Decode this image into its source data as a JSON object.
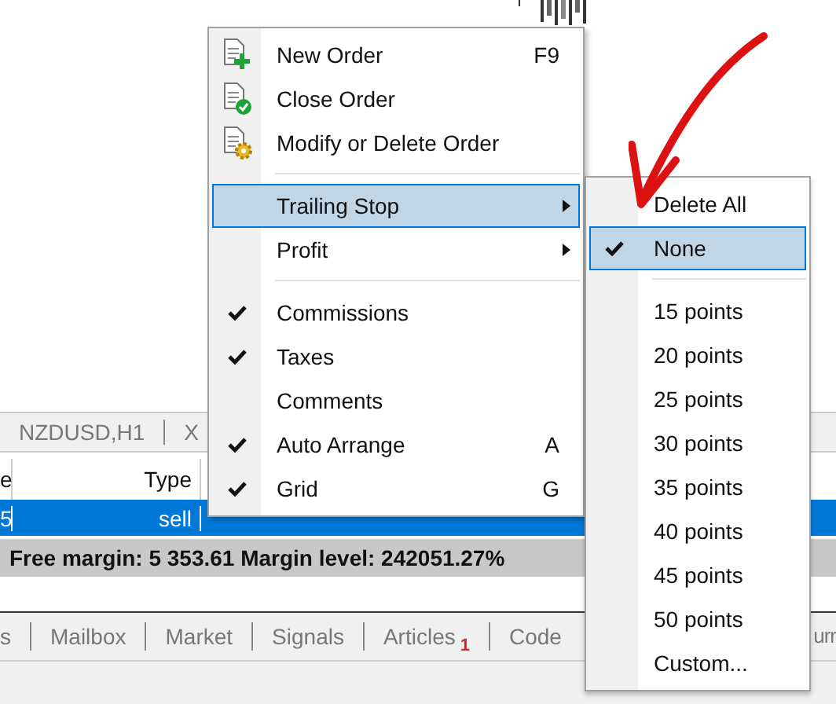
{
  "chart_tabs": [
    {
      "label": "NZDUSD,H1"
    },
    {
      "label": "X"
    }
  ],
  "table": {
    "columns": [
      "e",
      "Type"
    ],
    "rows": [
      {
        "cells": [
          "5",
          "sell"
        ],
        "selected": true
      }
    ]
  },
  "summary": "Free margin: 5 353.61  Margin level: 242051.27%",
  "bottom_tabs": [
    {
      "label": "s"
    },
    {
      "label": "Mailbox"
    },
    {
      "label": "Market"
    },
    {
      "label": "Signals"
    },
    {
      "label": "Articles",
      "badge": "1"
    },
    {
      "label": "Code"
    },
    {
      "label": "urr"
    }
  ],
  "context_menu": {
    "items": [
      {
        "kind": "item",
        "label": "New Order",
        "shortcut": "F9",
        "checked": false,
        "submenu": false,
        "selected": false
      },
      {
        "kind": "item",
        "label": "Close Order",
        "checked": false,
        "submenu": false,
        "selected": false
      },
      {
        "kind": "item",
        "label": "Modify or Delete Order",
        "checked": false,
        "submenu": false,
        "selected": false
      },
      {
        "kind": "separator"
      },
      {
        "kind": "item",
        "label": "Trailing Stop",
        "checked": false,
        "submenu": true,
        "selected": true
      },
      {
        "kind": "item",
        "label": "Profit",
        "checked": false,
        "submenu": true,
        "selected": false
      },
      {
        "kind": "separator"
      },
      {
        "kind": "item",
        "label": "Commissions",
        "checked": true,
        "submenu": false,
        "selected": false
      },
      {
        "kind": "item",
        "label": "Taxes",
        "checked": true,
        "submenu": false,
        "selected": false
      },
      {
        "kind": "item",
        "label": "Comments",
        "checked": false,
        "submenu": false,
        "selected": false
      },
      {
        "kind": "item",
        "label": "Auto Arrange",
        "shortcut": "A",
        "checked": true,
        "submenu": false,
        "selected": false
      },
      {
        "kind": "item",
        "label": "Grid",
        "shortcut": "G",
        "checked": true,
        "submenu": false,
        "selected": false
      }
    ]
  },
  "submenu": {
    "items": [
      {
        "kind": "item",
        "label": "Delete All",
        "checked": false,
        "selected": false
      },
      {
        "kind": "item",
        "label": "None",
        "checked": true,
        "selected": true
      },
      {
        "kind": "separator"
      },
      {
        "kind": "item",
        "label": "15 points",
        "checked": false,
        "selected": false
      },
      {
        "kind": "item",
        "label": "20 points",
        "checked": false,
        "selected": false
      },
      {
        "kind": "item",
        "label": "25 points",
        "checked": false,
        "selected": false
      },
      {
        "kind": "item",
        "label": "30 points",
        "checked": false,
        "selected": false
      },
      {
        "kind": "item",
        "label": "35 points",
        "checked": false,
        "selected": false
      },
      {
        "kind": "item",
        "label": "40 points",
        "checked": false,
        "selected": false
      },
      {
        "kind": "item",
        "label": "45 points",
        "checked": false,
        "selected": false
      },
      {
        "kind": "item",
        "label": "50 points",
        "checked": false,
        "selected": false
      },
      {
        "kind": "item",
        "label": "Custom...",
        "checked": false,
        "selected": false
      }
    ]
  }
}
